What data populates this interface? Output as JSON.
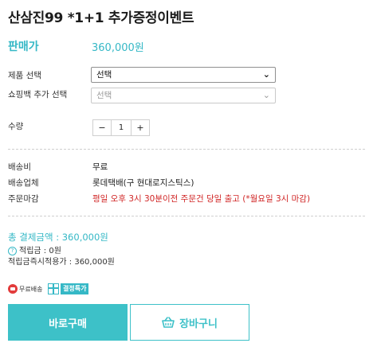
{
  "product": {
    "title": "산삼진99 *1+1 추가증정이벤트",
    "price_label": "판매가",
    "price_value": "360,000원"
  },
  "options": {
    "product_select": {
      "label": "제품 선택",
      "value": "선택"
    },
    "bag_select": {
      "label": "쇼핑백 추가 선택",
      "value": "선택"
    }
  },
  "quantity": {
    "label": "수량",
    "minus": "−",
    "value": "1",
    "plus": "+"
  },
  "shipping": {
    "fee_label": "배송비",
    "fee_value": "무료",
    "carrier_label": "배송업체",
    "carrier_value": "롯데택배(구 현대로지스틱스)",
    "cutoff_label": "주문마감",
    "cutoff_value": "평일 오후 3시 30분이전 주문건 당일 출고 (*월요일 3시 마감)"
  },
  "summary": {
    "total": "총 결제금액 : 360,000원",
    "points": "적립금 : 0원",
    "points_on_use": "적립금즉시적용가 : 360,000원"
  },
  "badges": {
    "free_shipping": "무료배송",
    "special_price": "결정특가"
  },
  "buttons": {
    "buy_now": "바로구매",
    "cart": "장바구니"
  },
  "icons": {
    "chevron": "chevron-down-icon",
    "cart": "basket-icon"
  },
  "colors": {
    "accent": "#35b8c6",
    "button": "#3dc1c8",
    "warning": "#d02525"
  }
}
